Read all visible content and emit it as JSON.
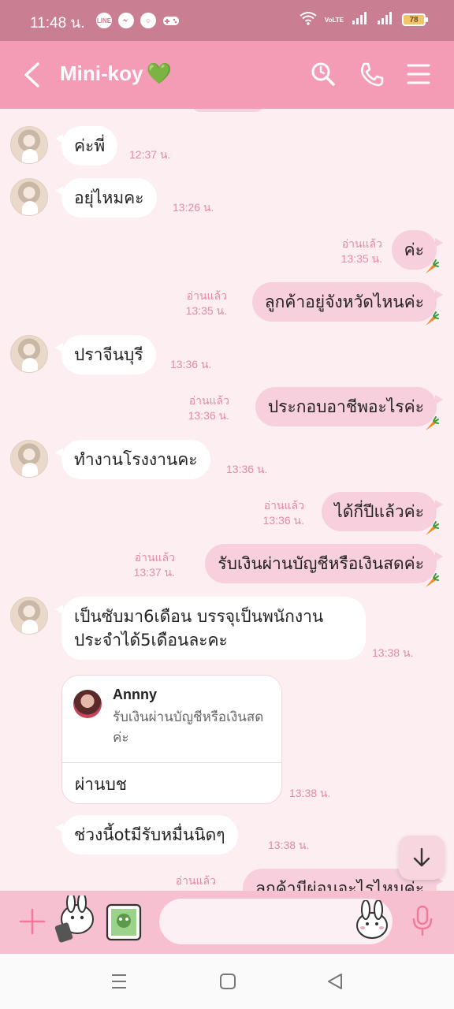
{
  "status_bar": {
    "time": "11:48 น.",
    "notif_icons": [
      "line-icon",
      "messenger-icon",
      "bot-icon",
      "gamepad-icon"
    ],
    "volte_label": "VoLTE",
    "battery": "78"
  },
  "header": {
    "title": "Mini-koy",
    "title_emoji": "💚",
    "icons": [
      "back-icon",
      "search-icon",
      "phone-icon",
      "menu-icon"
    ]
  },
  "messages": [
    {
      "dir": "in",
      "text": "ค่ะพี่",
      "time": "12:37 น."
    },
    {
      "dir": "in",
      "text": "อยุ่ไหมคะ",
      "time": "13:26 น."
    },
    {
      "dir": "out",
      "text": "ค่ะ",
      "read": "อ่านแล้ว",
      "time": "13:35 น."
    },
    {
      "dir": "out",
      "text": "ลูกค้าอยู่จังหวัดไหนค่ะ",
      "read": "อ่านแล้ว",
      "time": "13:35 น."
    },
    {
      "dir": "in",
      "text": "ปราจีนบุรี",
      "time": "13:36 น."
    },
    {
      "dir": "out",
      "text": "ประกอบอาชีพอะไรค่ะ",
      "read": "อ่านแล้ว",
      "time": "13:36 น."
    },
    {
      "dir": "in",
      "text": "ทำงานโรงงานคะ",
      "time": "13:36 น."
    },
    {
      "dir": "out",
      "text": "ได้กี่ปีแล้วค่ะ",
      "read": "อ่านแล้ว",
      "time": "13:36 น."
    },
    {
      "dir": "out",
      "text": "รับเงินผ่านบัญชีหรือเงินสดค่ะ",
      "read": "อ่านแล้ว",
      "time": "13:37 น."
    },
    {
      "dir": "in",
      "line1": "เป็นซับมา6เดือน บรรจุเป็นพนักงาน",
      "line2": "ประจำได้5เดือนละคะ",
      "time": "13:38 น."
    },
    {
      "dir": "in",
      "reply_name": "Annny",
      "reply_quote": "รับเงินผ่านบัญชีหรือเงินสดค่ะ",
      "text": "ผ่านบช",
      "time": "13:38 น."
    },
    {
      "dir": "in",
      "text": "ช่วงนี้otมีรับหมื่นนิดๆ",
      "time": "13:38 น."
    },
    {
      "dir": "out",
      "text": "ลูกค้ามีผ่อนอะไรไหมค่ะ",
      "read": "อ่านแล้ว"
    }
  ],
  "input_bar": {
    "icons": [
      "plus-icon",
      "sticker-icon",
      "photo-icon",
      "emoji-icon",
      "mic-icon"
    ]
  },
  "nav_bar": {
    "icons": [
      "recents-icon",
      "home-icon",
      "back-nav-icon"
    ]
  }
}
